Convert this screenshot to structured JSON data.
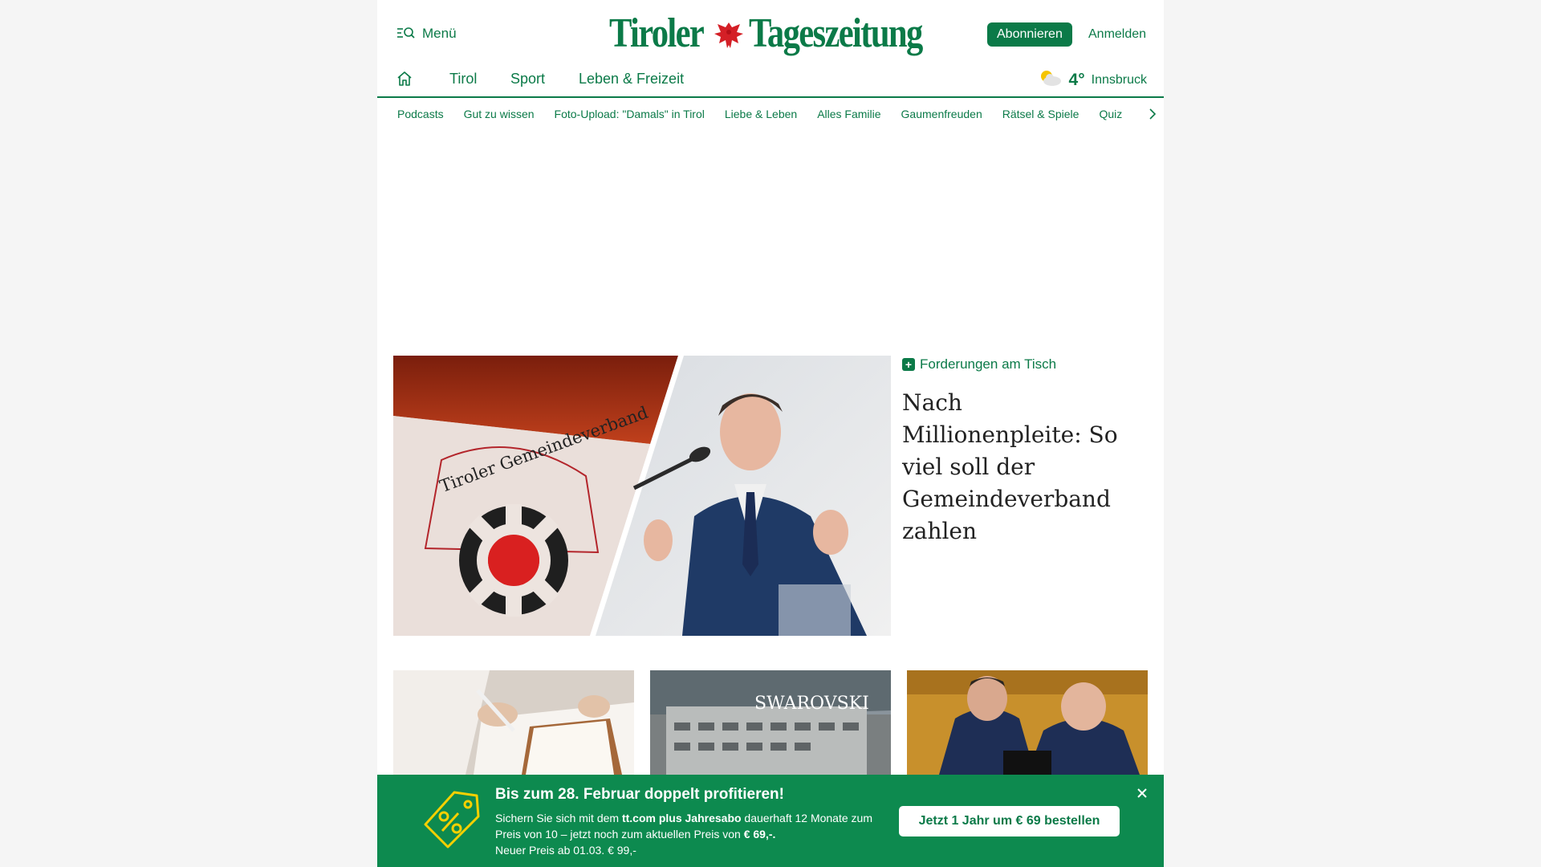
{
  "header": {
    "menu_label": "Menü",
    "logo_left": "Tiroler",
    "logo_right": "Tageszeitung",
    "subscribe_label": "Abonnieren",
    "login_label": "Anmelden"
  },
  "main_nav": {
    "items": [
      "Tirol",
      "Sport",
      "Leben & Freizeit"
    ]
  },
  "weather": {
    "temp": "4°",
    "city": "Innsbruck",
    "icon": "partly-cloudy-icon"
  },
  "sub_nav": {
    "items": [
      "Podcasts",
      "Gut zu wissen",
      "Foto-Upload: \"Damals\" in Tirol",
      "Liebe & Leben",
      "Alles Familie",
      "Gaumenfreuden",
      "Rätsel & Spiele",
      "Quiz"
    ]
  },
  "hero": {
    "kicker": "Forderungen am Tisch",
    "title": "Nach Millionenpleite: So viel soll der Gemeindeverband zahlen",
    "image_sign_text": "Tiroler Gemeindeverband"
  },
  "teasers": {
    "middle_sign": "SWAROVSKI"
  },
  "promo": {
    "title": "Bis zum 28. Februar doppelt profitieren!",
    "text_1": "Sichern Sie sich mit dem ",
    "text_bold_1": "tt.com plus Jahresabo",
    "text_2": " dauerhaft 12 Monate zum Preis von 10 – jetzt noch zum aktuellen Preis von ",
    "text_bold_2": "€ 69,-.",
    "text_3": "Neuer Preis ab 01.03. € 99,-",
    "button_label": "Jetzt 1 Jahr um € 69 bestellen"
  },
  "colors": {
    "brand": "#0b7a48",
    "promo_bg": "#0d8a4f"
  }
}
